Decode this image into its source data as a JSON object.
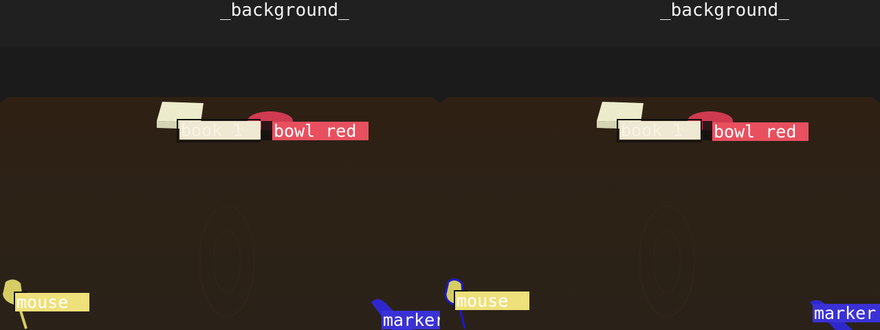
{
  "panels": [
    {
      "id": "left",
      "background_label": "_background_",
      "labels": {
        "book": "book_1",
        "bowl": "bowl_red",
        "mouse": "mouse",
        "marker": "marker"
      }
    },
    {
      "id": "right",
      "background_label": "_background_",
      "labels": {
        "book": "book_1",
        "bowl": "bowl_red",
        "mouse": "mouse",
        "marker": "marker"
      }
    }
  ],
  "colors": {
    "book": "#efe8d2",
    "bowl": "#e9505f",
    "mouse": "#eee07a",
    "marker": "#3a31d6",
    "table": "#2b2116",
    "wall": "#1d1d1d"
  }
}
